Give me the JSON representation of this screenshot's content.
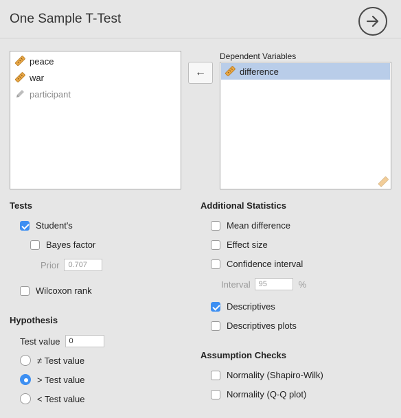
{
  "header": {
    "title": "One Sample T-Test"
  },
  "source": {
    "items": [
      {
        "label": "peace",
        "icon": "ruler-icon",
        "type": "scale"
      },
      {
        "label": "war",
        "icon": "ruler-icon",
        "type": "scale"
      },
      {
        "label": "participant",
        "icon": "pencil-icon",
        "type": "nominal"
      }
    ]
  },
  "assign_button": {
    "label": "←"
  },
  "dependent": {
    "title": "Dependent Variables",
    "items": [
      {
        "label": "difference",
        "icon": "ruler-icon",
        "selected": true
      }
    ]
  },
  "tests": {
    "title": "Tests",
    "students": {
      "label": "Student's",
      "checked": true
    },
    "bayes": {
      "label": "Bayes factor",
      "checked": false
    },
    "prior": {
      "label": "Prior",
      "value": "0.707"
    },
    "wilcoxon": {
      "label": "Wilcoxon rank",
      "checked": false
    }
  },
  "hypothesis": {
    "title": "Hypothesis",
    "test_value": {
      "label": "Test value",
      "value": "0"
    },
    "options": [
      {
        "label": "≠ Test value",
        "selected": false
      },
      {
        "label": "> Test value",
        "selected": true
      },
      {
        "label": "< Test value",
        "selected": false
      }
    ]
  },
  "additional": {
    "title": "Additional Statistics",
    "mean_diff": {
      "label": "Mean difference",
      "checked": false
    },
    "effect_size": {
      "label": "Effect size",
      "checked": false
    },
    "conf_interval": {
      "label": "Confidence interval",
      "checked": false
    },
    "interval": {
      "label": "Interval",
      "value": "95",
      "unit": "%"
    },
    "descriptives": {
      "label": "Descriptives",
      "checked": true
    },
    "desc_plots": {
      "label": "Descriptives plots",
      "checked": false
    }
  },
  "assumptions": {
    "title": "Assumption Checks",
    "shapiro": {
      "label": "Normality (Shapiro-Wilk)",
      "checked": false
    },
    "qq": {
      "label": "Normality (Q-Q plot)",
      "checked": false
    }
  },
  "colors": {
    "accent": "#3d8ff2",
    "selected_row": "#b9cde9",
    "ruler": "#e8a646"
  }
}
